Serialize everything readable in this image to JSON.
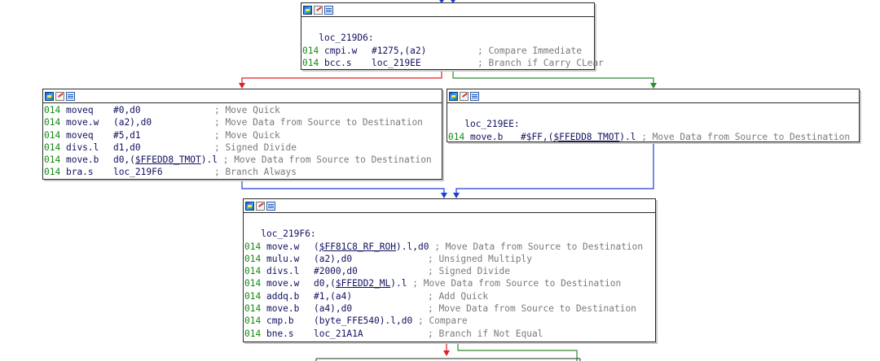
{
  "colors": {
    "edge_taken": "#2e8b2e",
    "edge_not_taken": "#e02020",
    "edge_unconditional": "#1f3fd0",
    "address_prefix": "#138a13",
    "comment": "#7a7a7a"
  },
  "icons": [
    "graph-overview-icon",
    "edit-node-icon",
    "node-list-icon"
  ],
  "blocks": {
    "b1": {
      "label": "loc_219D6:",
      "lines": [
        {
          "addr": "014",
          "mnemonic": "cmpi.w",
          "operands": "#1275,(a2)",
          "comment": "; Compare Immediate"
        },
        {
          "addr": "014",
          "mnemonic": "bcc.s",
          "operands": "loc_219EE",
          "comment": "; Branch if Carry CLear"
        }
      ]
    },
    "b2": {
      "lines": [
        {
          "addr": "014",
          "mnemonic": "moveq",
          "operands": "#0,d0",
          "comment": "; Move Quick"
        },
        {
          "addr": "014",
          "mnemonic": "move.w",
          "operands": "(a2),d0",
          "comment": "; Move Data from Source to Destination"
        },
        {
          "addr": "014",
          "mnemonic": "moveq",
          "operands": "#5,d1",
          "comment": "; Move Quick"
        },
        {
          "addr": "014",
          "mnemonic": "divs.l",
          "operands": "d1,d0",
          "comment": "; Signed Divide"
        },
        {
          "addr": "014",
          "mnemonic": "move.b",
          "operands_pre": "d0,(",
          "operands_sym": "$FFEDD8_TMOT",
          "operands_post": ").l",
          "comment": "; Move Data from Source to Destination"
        },
        {
          "addr": "014",
          "mnemonic": "bra.s",
          "operands": "loc_219F6",
          "comment": "; Branch Always"
        }
      ]
    },
    "b3": {
      "label": "loc_219EE:",
      "lines": [
        {
          "addr": "014",
          "mnemonic": "move.b",
          "operands_pre": "#$FF,(",
          "operands_sym": "$FFEDD8_TMOT",
          "operands_post": ").l",
          "comment": "; Move Data from Source to Destination"
        }
      ]
    },
    "b4": {
      "label": "loc_219F6:",
      "lines": [
        {
          "addr": "014",
          "mnemonic": "move.w",
          "operands_pre": "(",
          "operands_sym": "$FF81C8_RF_ROH",
          "operands_post": ").l,d0",
          "comment": "; Move Data from Source to Destination"
        },
        {
          "addr": "014",
          "mnemonic": "mulu.w",
          "operands": "(a2),d0",
          "comment": "; Unsigned Multiply"
        },
        {
          "addr": "014",
          "mnemonic": "divs.l",
          "operands": "#2000,d0",
          "comment": "; Signed Divide"
        },
        {
          "addr": "014",
          "mnemonic": "move.w",
          "operands_pre": "d0,(",
          "operands_sym": "$FFEDD2_ML",
          "operands_post": ").l",
          "comment": "; Move Data from Source to Destination"
        },
        {
          "addr": "014",
          "mnemonic": "addq.b",
          "operands": "#1,(a4)",
          "comment": "; Add Quick"
        },
        {
          "addr": "014",
          "mnemonic": "move.b",
          "operands": "(a4),d0",
          "comment": "; Move Data from Source to Destination"
        },
        {
          "addr": "014",
          "mnemonic": "cmp.b",
          "operands": "(byte_FFE540).l,d0",
          "comment": "; Compare"
        },
        {
          "addr": "014",
          "mnemonic": "bne.s",
          "operands": "loc_21A1A",
          "comment": "; Branch if Not Equal"
        }
      ]
    }
  }
}
